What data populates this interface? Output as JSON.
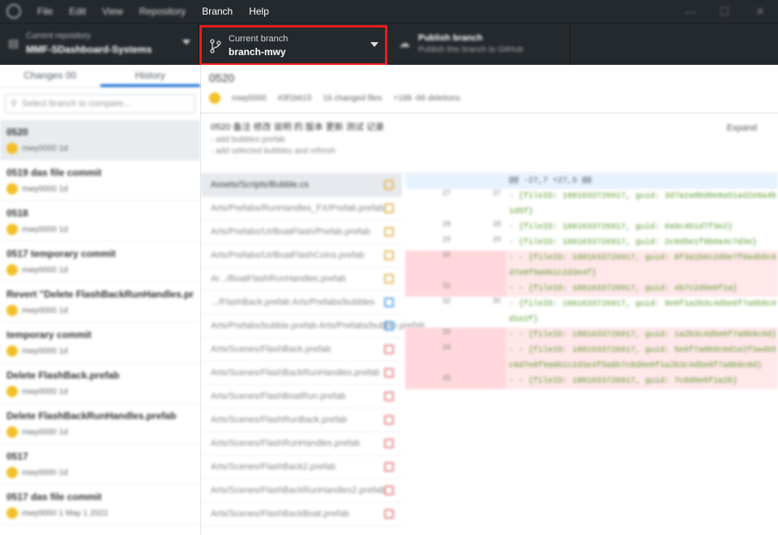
{
  "menu": [
    "File",
    "Edit",
    "View",
    "Repository",
    "Branch",
    "Help"
  ],
  "repo": {
    "label": "Current repository",
    "value": "MMF-SDashboard-Systems"
  },
  "branch": {
    "label": "Current branch",
    "value": "branch-mwy"
  },
  "fetch": {
    "label": "Publish branch",
    "value": "Publish this branch to GitHub"
  },
  "tabs": [
    "Changes 00",
    "History"
  ],
  "filter_placeholder": "Select branch to compare...",
  "commits": [
    {
      "summary": "0520",
      "meta": "mwy0000 1d"
    },
    {
      "summary": "0519 das file commit",
      "meta": "mwy0000 1d"
    },
    {
      "summary": "0518",
      "meta": "mwy0000 1d"
    },
    {
      "summary": "0517 temporary commit",
      "meta": "mwy0000 1d"
    },
    {
      "summary": "Revert \"Delete FlashBackRunHandles.prefab\"",
      "meta": "mwy0000 1d"
    },
    {
      "summary": "temporary commit",
      "meta": "mwy0000 1d"
    },
    {
      "summary": "Delete FlashBack.prefab",
      "meta": "mwy0000 1d"
    },
    {
      "summary": "Delete FlashBackRunHandles.prefab",
      "meta": "mwy0000 1d"
    },
    {
      "summary": "0517",
      "meta": "mwy0000 1d"
    },
    {
      "summary": "0517 das file commit",
      "meta": "mwy0000 1 May 1 2022"
    }
  ],
  "commit_head": {
    "title": "0520",
    "author": "mwy0000",
    "sha": "#3f1b615",
    "changed": "16 changed files",
    "added": "+188 -66 deletions"
  },
  "commit_desc": {
    "line1": "0520 备注 修改 说明 的 版本 更新 测试 记录",
    "line2": "- add bubbles prefab",
    "line3": "- add selected bubbles and refresh",
    "expand": "Expand"
  },
  "files": [
    {
      "name": "Assets/Scripts/Bubble.cs",
      "status": "modified"
    },
    {
      "name": "Arts/Prefabs/RunHandles_FX/Prefab.prefab",
      "status": "modified"
    },
    {
      "name": "Arts/Prefabs/UI/BoatFlash/Prefab.prefab",
      "status": "modified"
    },
    {
      "name": "Arts/Prefabs/UI/BoatFlashCoins.prefab",
      "status": "modified"
    },
    {
      "name": "Ar.../BoatFlashRunHandles.prefab",
      "status": "modified"
    },
    {
      "name": ".../FlashBack.prefab  Arts/Prefabs/bubbles",
      "status": "added"
    },
    {
      "name": "Arts/Prefabs/bubble.prefab  Arts/Prefabs/bubble.prefab",
      "status": "added"
    },
    {
      "name": "Arts/Scenes/FlashBack.prefab",
      "status": "deleted"
    },
    {
      "name": "Arts/Scenes/FlashBackRunHandles.prefab",
      "status": "deleted"
    },
    {
      "name": "Arts/Scenes/FlashBoatRun.prefab",
      "status": "deleted"
    },
    {
      "name": "Arts/Scenes/FlashRunBack.prefab",
      "status": "deleted"
    },
    {
      "name": "Arts/Scenes/FlashRunHandles.prefab",
      "status": "deleted"
    },
    {
      "name": "Arts/Scenes/FlashBack2.prefab",
      "status": "deleted"
    },
    {
      "name": "Arts/Scenes/FlashBackRunHandles2.prefab",
      "status": "deleted"
    },
    {
      "name": "Arts/Scenes/FlashBackBoat.prefab",
      "status": "deleted"
    }
  ],
  "diff": [
    {
      "type": "hunk",
      "n1": "",
      "n2": "",
      "code": "@@ -27,7 +27,5 @@"
    },
    {
      "type": "ctx",
      "n1": "27",
      "n2": "27",
      "code": "    - {fileID: 1881633726917, guid: 3d7a2a8bd8e8a51ad2e8a4b1d5f}"
    },
    {
      "type": "ctx",
      "n1": "28",
      "n2": "28",
      "code": "    - {fileID: 1881633726917, guid: 6a9c4b1d7f3e2}"
    },
    {
      "type": "ctx",
      "n1": "29",
      "n2": "29",
      "code": "    - {fileID: 1881633726917, guid: 2c8d5e1f9b0a4c7d3e}"
    },
    {
      "type": "del",
      "n1": "30",
      "n2": "",
      "code": "-   - {fileID: 1881633726917, guid: 8f3a1b6c2d9e7f0a4b5c6d7e8f9a0b1c2d3e4f}"
    },
    {
      "type": "del",
      "n1": "31",
      "n2": "",
      "code": "-   - {fileID: 1881633726917, guid: 4b7c2d9e0f1a}"
    },
    {
      "type": "ctx",
      "n1": "32",
      "n2": "30",
      "code": "    - {fileID: 1881633726917, guid: 9e0f1a2b3c4d5e6f7a8b9c0d1e2f}"
    },
    {
      "type": "del",
      "n1": "33",
      "n2": "",
      "code": "-   - {fileID: 1881633726917, guid: 1a2b3c4d5e6f7a8b9c0d}"
    },
    {
      "type": "del",
      "n1": "34",
      "n2": "",
      "code": "-   - {fileID: 1881633726917, guid: 5e6f7a8b9c0d1e2f3a4b5c6d7e8f9a0b1c2d3e4f5a6b7c8d9e0f1a2b3c4d5e6f7a8b9c0d}"
    },
    {
      "type": "del",
      "n1": "35",
      "n2": "",
      "code": "-   - {fileID: 1881633726917, guid: 7c8d9e0f1a2b}"
    }
  ]
}
